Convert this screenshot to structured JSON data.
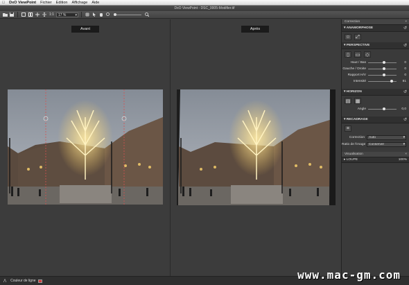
{
  "menubar": {
    "app": "DxO ViewPoint",
    "items": [
      "Fichier",
      "Edition",
      "Affichage",
      "Aide"
    ]
  },
  "window": {
    "title": "DxO ViewPoint - DSC_0005-Modifier.tif"
  },
  "toolbar": {
    "ratio_label": "1:1",
    "zoom_value": "17 %"
  },
  "viewer": {
    "before_label": "Avant",
    "after_label": "Après"
  },
  "panel": {
    "header": "Correction",
    "anamorphose": {
      "title": "ANAMORPHOSE"
    },
    "perspective": {
      "title": "PERSPECTIVE",
      "sliders": [
        {
          "label": "Haut / Bas",
          "value": "0",
          "level": 0.55
        },
        {
          "label": "Gauche / Droite",
          "value": "0",
          "level": 0.55
        },
        {
          "label": "Rapport H/V",
          "value": "0",
          "level": 0.55
        },
        {
          "label": "Intensité",
          "value": "81",
          "level": 0.82
        }
      ]
    },
    "horizon": {
      "title": "HORIZON",
      "angle_label": "Angle",
      "angle_value": "0,0",
      "level": 0.55
    },
    "recadrage": {
      "title": "RECADRAGE",
      "correction_label": "Correction",
      "correction_value": "Auto",
      "ratio_label": "Ratio de l'image",
      "ratio_value": "Conserver"
    },
    "visualisation": "Visualisation",
    "loupe": {
      "label": "LOUPE",
      "value": "100%"
    }
  },
  "statusbar": {
    "line_color_label": "Couleur de ligne",
    "line_color": "#d13a3a"
  },
  "watermark": "www.mac-gm.com"
}
